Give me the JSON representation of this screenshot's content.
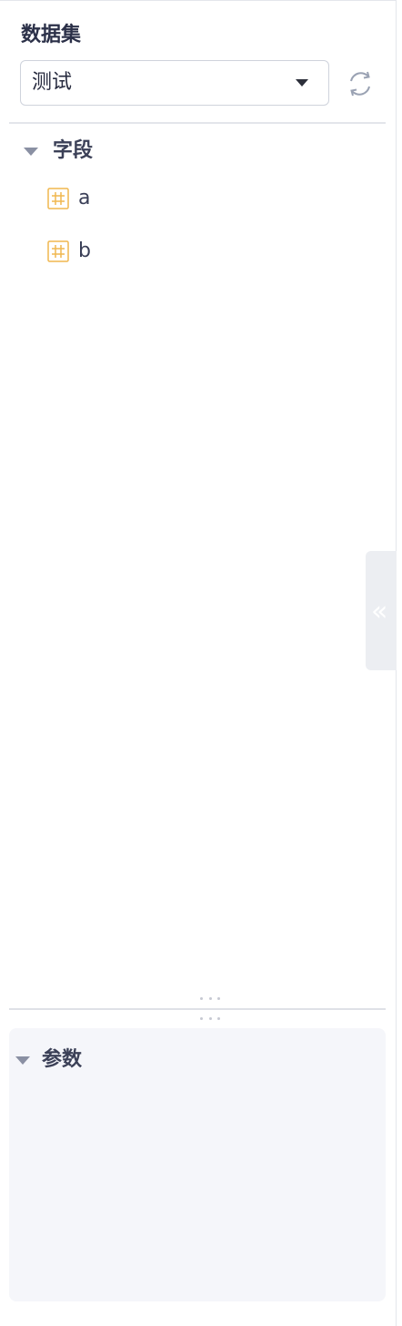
{
  "dataset": {
    "title": "数据集",
    "selected": "测试"
  },
  "fields": {
    "title": "字段",
    "items": [
      {
        "label": "a",
        "icon": "grid-field-icon"
      },
      {
        "label": "b",
        "icon": "grid-field-icon"
      }
    ]
  },
  "params": {
    "title": "参数"
  },
  "colors": {
    "field_icon": "#f0b74f",
    "panel_bg": "#f5f6fa",
    "collapse_tab_bg": "#eceef2"
  },
  "icons": {
    "refresh": "refresh-icon",
    "collapse": "double-chevron-left-icon",
    "expand_field": "caret-down-icon"
  }
}
